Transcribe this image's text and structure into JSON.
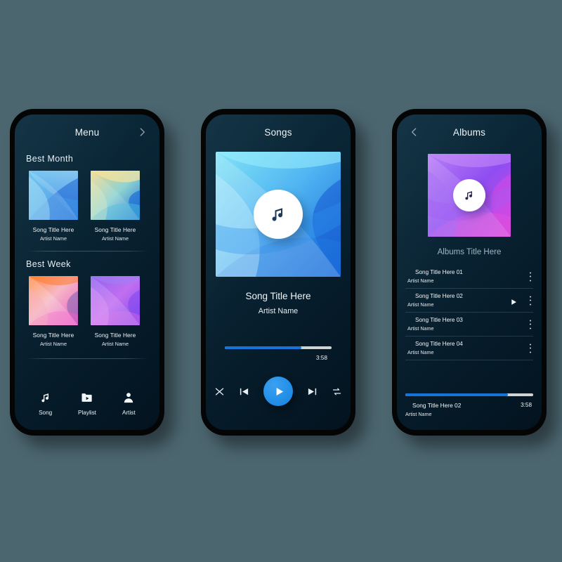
{
  "theme": {
    "page_background": "#4c6670",
    "screen_background": "#0a2636",
    "accent": "#1673d8",
    "play_button": "#2390e8",
    "text_primary": "#f1f6f9",
    "text_muted": "#9fb6c4",
    "progress_track": "#cdd4d3"
  },
  "menu_screen": {
    "title": "Menu",
    "forward_icon": "chevron-right-icon",
    "sections": [
      {
        "heading": "Best Month",
        "cards": [
          {
            "title": "Song Title Here",
            "artist": "Artist Name",
            "art": "blue-fan"
          },
          {
            "title": "Song Title Here",
            "artist": "Artist Name",
            "art": "gold-teal-fan"
          }
        ]
      },
      {
        "heading": "Best Week",
        "cards": [
          {
            "title": "Song Title Here",
            "artist": "Artist Name",
            "art": "orange-pink-fan"
          },
          {
            "title": "Song Title Here",
            "artist": "Artist Name",
            "art": "violet-fan"
          }
        ]
      }
    ],
    "bottom_nav": [
      {
        "label": "Song",
        "icon": "music-note-icon"
      },
      {
        "label": "Playlist",
        "icon": "folder-play-icon"
      },
      {
        "label": "Artist",
        "icon": "person-icon"
      }
    ]
  },
  "player_screen": {
    "title": "Songs",
    "album_art": "blue-fan-large",
    "art_badge_icon": "music-note-icon",
    "song_title": "Song Title Here",
    "artist": "Artist Name",
    "progress_percent": 72,
    "time": "3:58",
    "controls": [
      {
        "name": "shuffle-button",
        "icon": "shuffle-icon"
      },
      {
        "name": "previous-button",
        "icon": "skip-previous-icon"
      },
      {
        "name": "play-button",
        "icon": "play-icon"
      },
      {
        "name": "next-button",
        "icon": "skip-next-icon"
      },
      {
        "name": "repeat-button",
        "icon": "repeat-icon"
      }
    ]
  },
  "albums_screen": {
    "title": "Albums",
    "back_icon": "chevron-left-icon",
    "album_art": "violet-fan-large",
    "art_badge_icon": "music-note-icon",
    "album_title": "Albums Title Here",
    "tracks": [
      {
        "title": "Song Title Here 01",
        "artist": "Artist Name",
        "playing": false,
        "menu_icon": "more-vertical-icon"
      },
      {
        "title": "Song Title Here 02",
        "artist": "Artist Name",
        "playing": true,
        "play_icon": "play-icon",
        "menu_icon": "more-vertical-icon"
      },
      {
        "title": "Song Title Here 03",
        "artist": "Artist Name",
        "playing": false,
        "menu_icon": "more-vertical-icon"
      },
      {
        "title": "Song Title Here 04",
        "artist": "Artist Name",
        "playing": false,
        "menu_icon": "more-vertical-icon"
      }
    ],
    "now_playing": {
      "title": "Song Title Here 02",
      "artist": "Artist Name",
      "time": "3:58",
      "progress_percent": 80
    }
  }
}
